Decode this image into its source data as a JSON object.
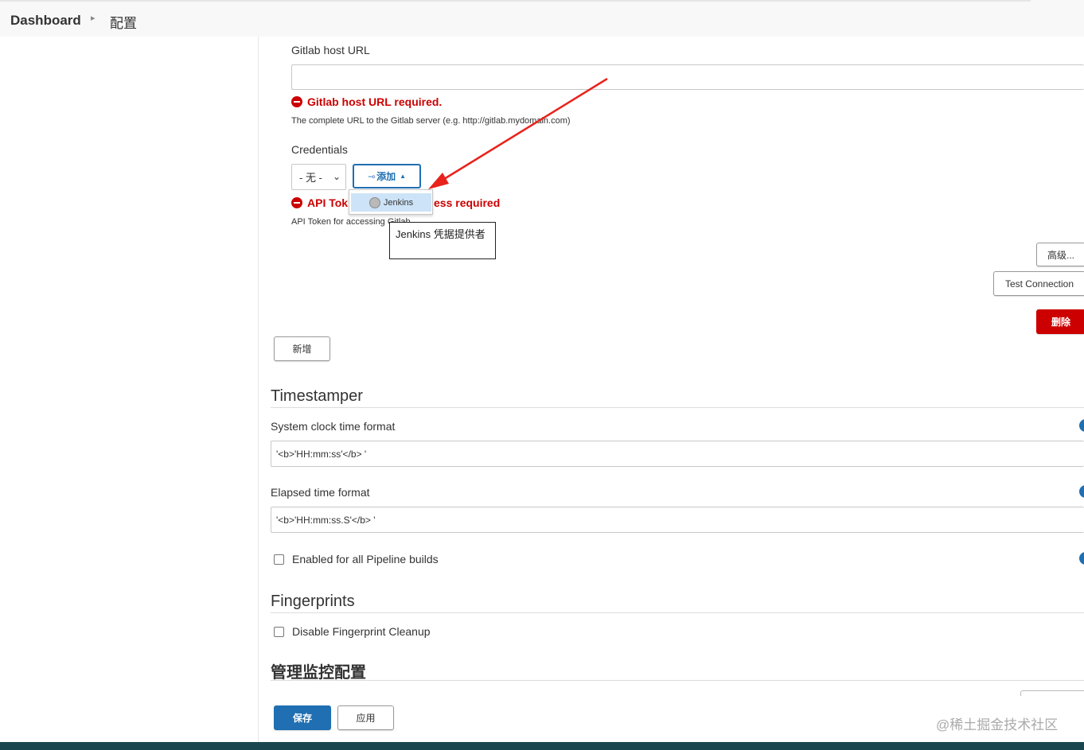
{
  "breadcrumb": {
    "home": "Dashboard",
    "current": "配置"
  },
  "gitlab": {
    "host_label": "Gitlab host URL",
    "host_value": "",
    "host_error": "Gitlab host URL required.",
    "host_help": "The complete URL to the Gitlab server (e.g. http://gitlab.mydomain.com)",
    "credentials_label": "Credentials",
    "credentials_select": "- 无 -",
    "add_button": "添加",
    "token_error_prefix": "API Tok",
    "token_error_suffix": "ess required",
    "token_help": "API Token for accessing Gitlab",
    "dropdown_item": "Jenkins",
    "tooltip": "Jenkins 凭据提供者",
    "advanced_button": "高级...",
    "test_button": "Test Connection",
    "delete_button": "删除",
    "new_button": "新增"
  },
  "timestamper": {
    "title": "Timestamper",
    "clock_label": "System clock time format",
    "clock_value": "'<b>'HH:mm:ss'</b> '",
    "elapsed_label": "Elapsed time format",
    "elapsed_value": "'<b>'HH:mm:ss.S'</b> '",
    "pipeline_label": "Enabled for all Pipeline builds",
    "pipeline_checked": false
  },
  "fingerprints": {
    "title": "Fingerprints",
    "cleanup_label": "Disable Fingerprint Cleanup",
    "cleanup_checked": false
  },
  "monitor": {
    "title": "管理监控配置"
  },
  "footer": {
    "save_button": "保存",
    "apply_button": "应用"
  },
  "watermark": "@稀土掘金技术社区",
  "colors": {
    "error": "#cc0000",
    "primary": "#1f6fb2",
    "danger": "#cc0000",
    "footer": "#1a4650"
  }
}
